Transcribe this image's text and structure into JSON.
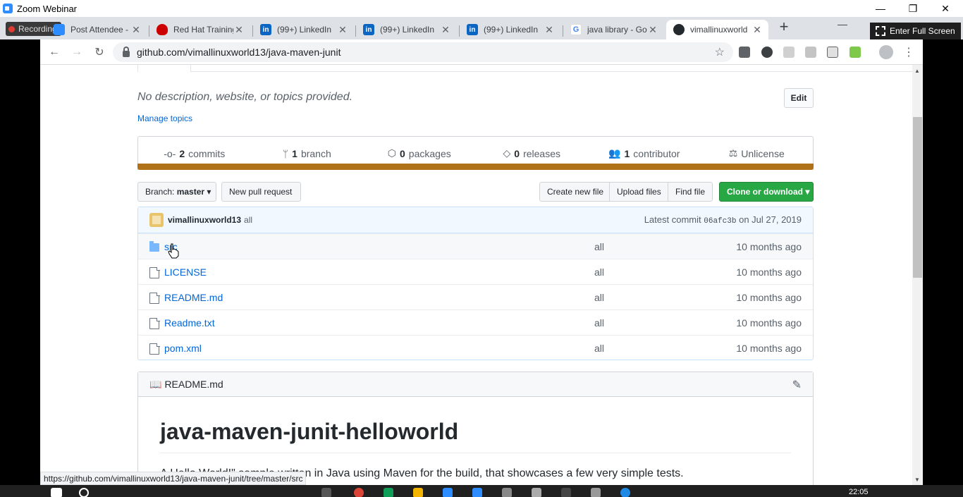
{
  "zoom": {
    "title": "Zoom Webinar"
  },
  "recording": {
    "label": "Recording"
  },
  "tabs": [
    {
      "title": "Post Attendee -",
      "icon": "zoom-icon",
      "color": "#2d8cff"
    },
    {
      "title": "Red Hat Training",
      "icon": "redhat-icon",
      "color": "#cc0000"
    },
    {
      "title": "(99+) LinkedIn",
      "icon": "linkedin-icon",
      "color": "#0a66c2"
    },
    {
      "title": "(99+) LinkedIn",
      "icon": "linkedin-icon",
      "color": "#0a66c2"
    },
    {
      "title": "(99+) LinkedIn",
      "icon": "linkedin-icon",
      "color": "#0a66c2"
    },
    {
      "title": "java library - Go",
      "icon": "google-icon",
      "color": "#4285f4"
    },
    {
      "title": "vimallinuxworld",
      "icon": "github-icon",
      "color": "#24292e"
    }
  ],
  "fullscreen": {
    "label": "Enter Full Screen"
  },
  "browser": {
    "url": "github.com/vimallinuxworld13/java-maven-junit"
  },
  "repo": {
    "description": "No description, website, or topics provided.",
    "edit_label": "Edit",
    "manage_topics": "Manage topics",
    "stats": [
      {
        "count": "2",
        "label": "commits",
        "icon": "commit-icon",
        "glyph": "-o-"
      },
      {
        "count": "1",
        "label": "branch",
        "icon": "branch-icon",
        "glyph": "ᛘ"
      },
      {
        "count": "0",
        "label": "packages",
        "icon": "package-icon",
        "glyph": "⬡"
      },
      {
        "count": "0",
        "label": "releases",
        "icon": "tag-icon",
        "glyph": "◇"
      },
      {
        "count": "1",
        "label": "contributor",
        "icon": "people-icon",
        "glyph": "👥"
      },
      {
        "count": "",
        "label": "Unlicense",
        "icon": "law-icon",
        "glyph": "⚖"
      }
    ],
    "language_color": "#b07219",
    "branch_prefix": "Branch:",
    "branch_name": "master",
    "new_pull_request": "New pull request",
    "create_new_file": "Create new file",
    "upload_files": "Upload files",
    "find_file": "Find file",
    "clone_or_download": "Clone or download",
    "latest_commit": {
      "author": "vimallinuxworld13",
      "message": "all",
      "prefix": "Latest commit",
      "sha": "06afc3b",
      "date": "on Jul 27, 2019"
    },
    "files": [
      {
        "name": "src",
        "type": "folder",
        "message": "all",
        "age": "10 months ago"
      },
      {
        "name": "LICENSE",
        "type": "file",
        "message": "all",
        "age": "10 months ago"
      },
      {
        "name": "README.md",
        "type": "file",
        "message": "all",
        "age": "10 months ago"
      },
      {
        "name": "Readme.txt",
        "type": "file",
        "message": "all",
        "age": "10 months ago"
      },
      {
        "name": "pom.xml",
        "type": "file",
        "message": "all",
        "age": "10 months ago"
      }
    ],
    "readme": {
      "filename": "README.md",
      "title": "java-maven-junit-helloworld",
      "text": "A Hello World!\" sample written in Java using Maven for the build, that showcases a few very simple tests."
    }
  },
  "status_url": "https://github.com/vimallinuxworld13/java-maven-junit/tree/master/src",
  "taskbar": {
    "clock": "22:05"
  }
}
